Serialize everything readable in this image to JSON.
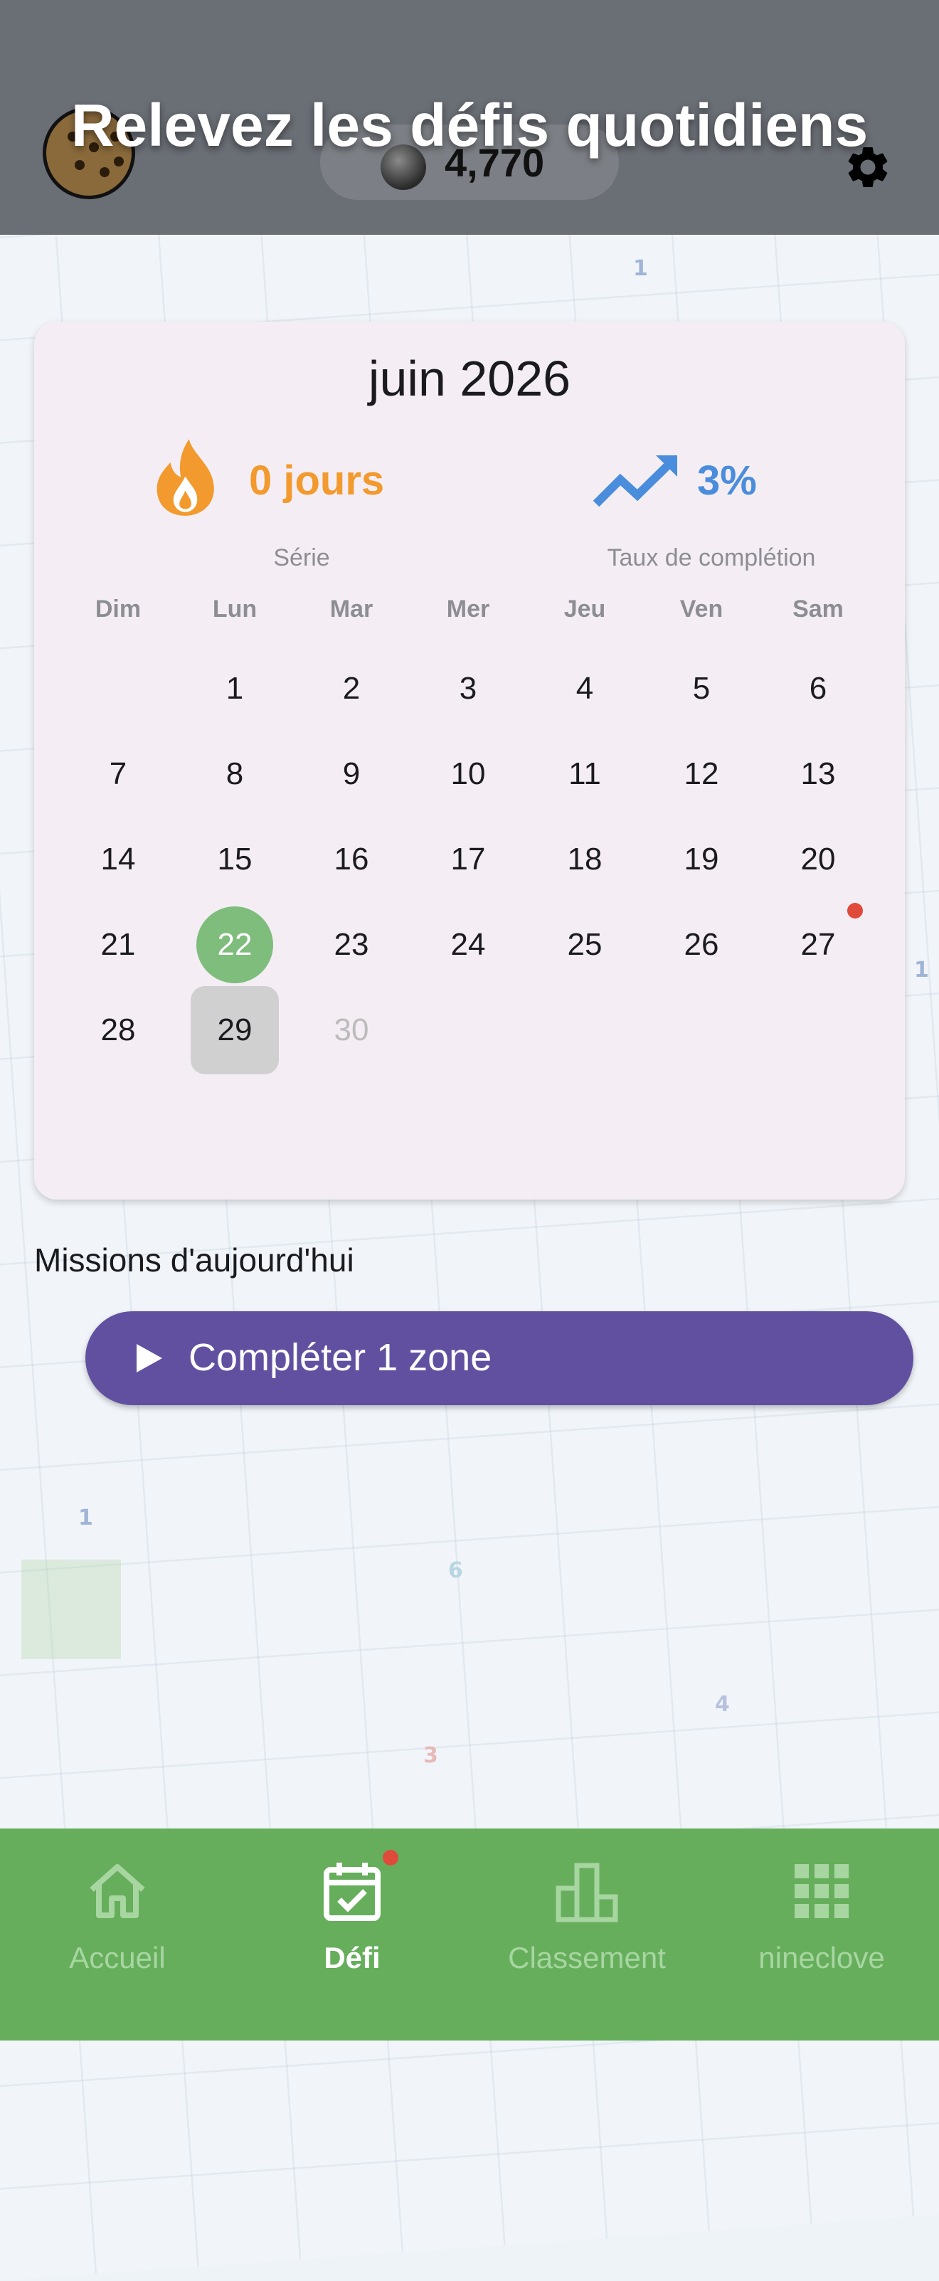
{
  "header": {
    "title": "Relevez les défis quotidiens",
    "coins": "4,770"
  },
  "calendar": {
    "month": "juin 2026",
    "streak_value": "0 jours",
    "streak_label": "Série",
    "completion_value": "3%",
    "completion_label": "Taux de complétion",
    "weekdays": [
      "Dim",
      "Lun",
      "Mar",
      "Mer",
      "Jeu",
      "Ven",
      "Sam"
    ],
    "weeks": [
      [
        "",
        "1",
        "2",
        "3",
        "4",
        "5",
        "6"
      ],
      [
        "7",
        "8",
        "9",
        "10",
        "11",
        "12",
        "13"
      ],
      [
        "14",
        "15",
        "16",
        "17",
        "18",
        "19",
        "20"
      ],
      [
        "21",
        "22",
        "23",
        "24",
        "25",
        "26",
        "27"
      ],
      [
        "28",
        "29",
        "30",
        "",
        "",
        "",
        ""
      ]
    ],
    "completed_day": "22",
    "today": "29",
    "future_day": "30"
  },
  "missions": {
    "title": "Missions d'aujourd'hui",
    "items": [
      {
        "label": "Compléter 1 zone"
      }
    ]
  },
  "nav": {
    "items": [
      {
        "label": "Accueil",
        "icon": "home-icon"
      },
      {
        "label": "Défi",
        "icon": "calendar-check-icon"
      },
      {
        "label": "Classement",
        "icon": "bar-chart-icon"
      },
      {
        "label": "nineclove",
        "icon": "grid-icon"
      }
    ]
  },
  "colors": {
    "accent_purple": "#6150a0",
    "nav_green": "#66ae5c",
    "streak_orange": "#f29a2e",
    "completion_blue": "#4a8ddc",
    "done_green": "#7ebd7c",
    "notification_red": "#e04a3a"
  }
}
